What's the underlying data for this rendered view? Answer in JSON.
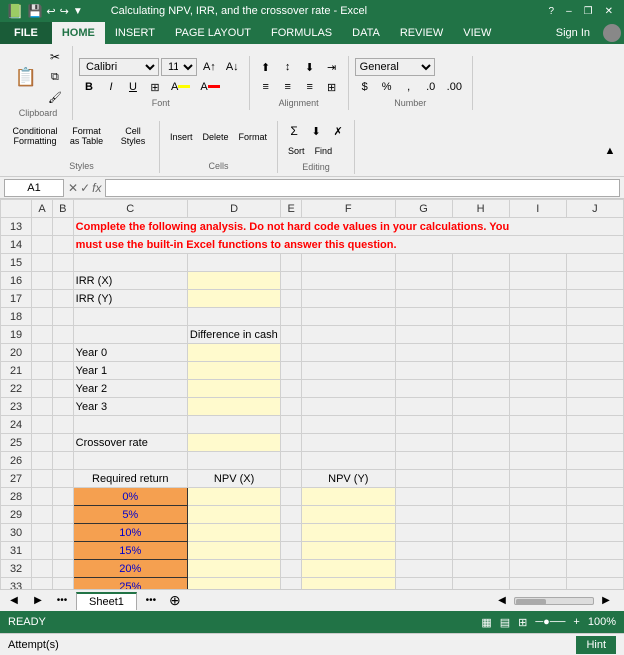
{
  "titleBar": {
    "title": "Calculating NPV, IRR, and the crossover rate - Excel",
    "helpBtn": "?",
    "minimizeBtn": "–",
    "restoreBtn": "❐",
    "closeBtn": "✕"
  },
  "ribbon": {
    "tabs": [
      {
        "label": "FILE",
        "id": "file",
        "active": false,
        "isFile": true
      },
      {
        "label": "HOME",
        "id": "home",
        "active": true
      },
      {
        "label": "INSERT",
        "id": "insert",
        "active": false
      },
      {
        "label": "PAGE LAYOUT",
        "id": "page-layout",
        "active": false
      },
      {
        "label": "FORMULAS",
        "id": "formulas",
        "active": false
      },
      {
        "label": "DATA",
        "id": "data",
        "active": false
      },
      {
        "label": "REVIEW",
        "id": "review",
        "active": false
      },
      {
        "label": "VIEW",
        "id": "view",
        "active": false
      }
    ],
    "signIn": "Sign In"
  },
  "toolbar": {
    "clipboardLabel": "Clipboard",
    "pasteLabel": "Paste",
    "fontLabel": "Font",
    "fontName": "Calibri",
    "fontSize": "11",
    "boldLabel": "B",
    "italicLabel": "I",
    "underlineLabel": "U",
    "alignmentLabel": "Alignment",
    "numberLabel": "Number",
    "conditionalLabel": "Conditional Formatting",
    "formatTableLabel": "Format as Table",
    "cellStylesLabel": "Cell Styles",
    "stylesLabel": "Styles",
    "cellsLabel": "Cells",
    "editingLabel": "Editing"
  },
  "formulaBar": {
    "cellRef": "A1",
    "formula": ""
  },
  "columns": [
    "",
    "A",
    "B",
    "C",
    "D",
    "E",
    "F",
    "G",
    "H",
    "I",
    "J"
  ],
  "rows": {
    "13": {
      "c": "Complete the following analysis. Do not hard code values in your calculations. You",
      "d": ""
    },
    "14": {
      "c": "must use the built-in Excel functions to answer this question."
    },
    "15": {},
    "16": {
      "c": "IRR (X)"
    },
    "17": {
      "c": "IRR (Y)"
    },
    "18": {},
    "19": {
      "c": "",
      "d": "Difference in cash flows"
    },
    "20": {
      "c": "Year 0"
    },
    "21": {
      "c": "Year 1"
    },
    "22": {
      "c": "Year 2"
    },
    "23": {
      "c": "Year 3"
    },
    "24": {},
    "25": {
      "c": "Crossover rate"
    },
    "26": {},
    "27": {
      "c": "Required return",
      "d": "NPV (X)",
      "f": "NPV (Y)"
    },
    "28": {
      "c": "0%"
    },
    "29": {
      "c": "5%"
    },
    "30": {
      "c": "10%"
    },
    "31": {
      "c": "15%"
    },
    "32": {
      "c": "20%"
    },
    "33": {
      "c": "25%"
    },
    "34": {}
  },
  "status": {
    "ready": "READY",
    "zoom": "100%"
  },
  "bottomBar": {
    "attempts": "Attempt(s)",
    "hint": "Hint"
  },
  "sheets": [
    "Sheet1"
  ]
}
